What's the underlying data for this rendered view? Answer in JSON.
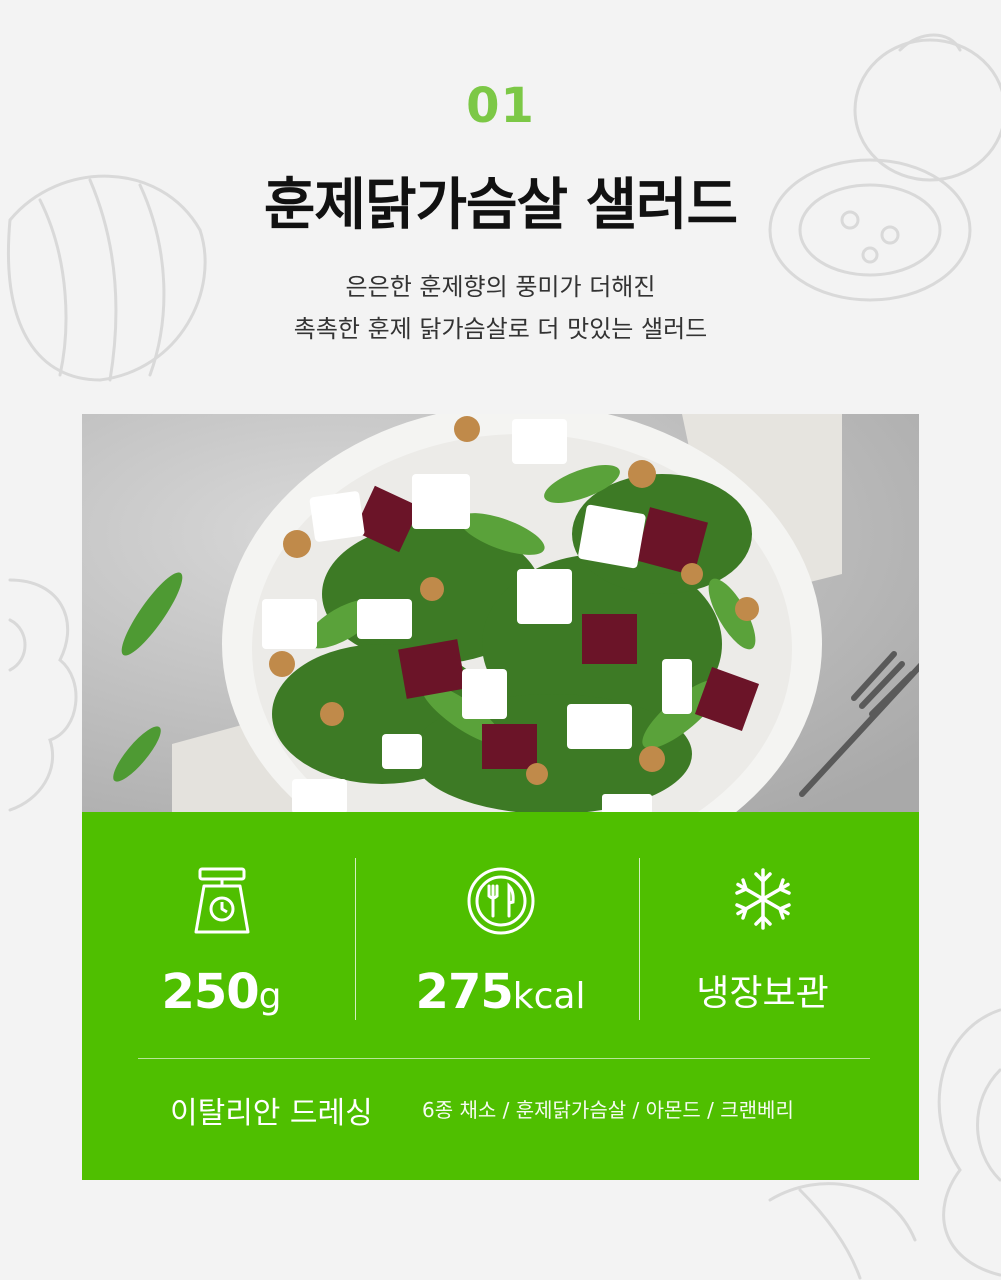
{
  "section": {
    "number": "01",
    "title": "훈제닭가슴살 샐러드",
    "description_line1": "은은한 훈제향의 풍미가 더해진",
    "description_line2": "촉촉한 훈제 닭가슴살로 더 맛있는 샐러드"
  },
  "specs": {
    "weight": {
      "value": "250",
      "unit": "g",
      "icon": "kitchen-scale-icon"
    },
    "calories": {
      "value": "275",
      "unit": "kcal",
      "icon": "plate-fork-knife-icon"
    },
    "storage": {
      "label": "냉장보관",
      "icon": "snowflake-icon"
    }
  },
  "details": {
    "dressing": "이탈리안 드레싱",
    "ingredients": "6종 채소 / 훈제닭가슴살 / 아몬드 / 크랜베리"
  },
  "colors": {
    "accent": "#7cc846",
    "panel": "#4fbf00",
    "background": "#f3f3f3"
  }
}
